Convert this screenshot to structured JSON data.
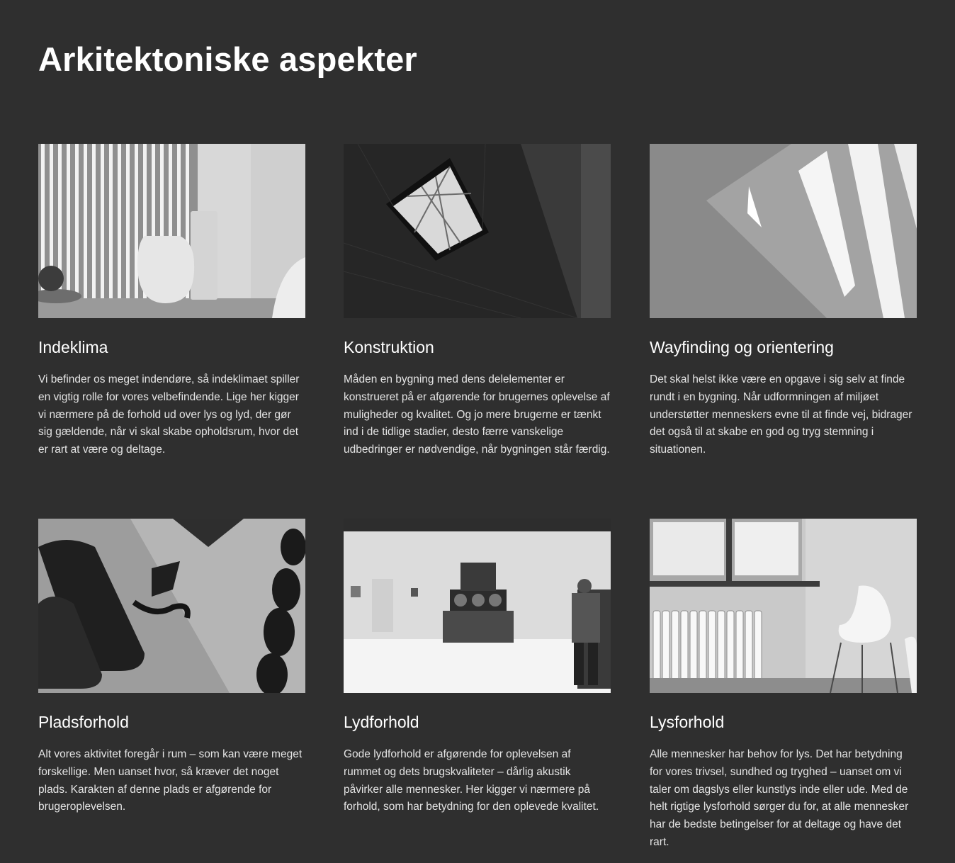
{
  "page": {
    "title": "Arkitektoniske aspekter"
  },
  "cards": [
    {
      "title": "Indeklima",
      "text": "Vi befinder os meget indendøre, så indeklimaet spiller en vigtig rolle for vores velbefindende. Lige her kigger vi nærmere på de forhold ud over lys og lyd, der gør sig gældende, når vi skal skabe opholdsrum, hvor det er rart at være og deltage."
    },
    {
      "title": "Konstruktion",
      "text": "Måden en bygning med dens delelementer er konstrueret på er afgørende for brugernes oplevelse af muligheder og kvalitet. Og jo mere brugerne er tænkt ind i de tidlige stadier, desto færre vanskelige udbedringer er nødvendige, når bygningen står færdig."
    },
    {
      "title": "Wayfinding og orientering",
      "text": "Det skal helst ikke være en opgave i sig selv at finde rundt i en bygning. Når udformningen af miljøet understøtter menneskers evne til at finde vej, bidrager det også til at skabe en god og tryg stemning i situationen."
    },
    {
      "title": "Pladsforhold",
      "text": "Alt vores aktivitet foregår i rum – som kan være meget forskellige. Men uanset hvor, så kræver det noget plads. Karakten af denne plads er afgørende for brugeroplevelsen."
    },
    {
      "title": "Lydforhold",
      "text": "Gode lydforhold er afgørende for oplevelsen af rummet og dets brugskvaliteter – dårlig akustik påvirker alle mennesker. Her kigger vi nærmere på forhold, som har betydning for den oplevede kvalitet."
    },
    {
      "title": "Lysforhold",
      "text": "Alle mennesker har behov for lys. Det har betydning for vores trivsel, sundhed og tryghed – uanset om vi taler om dagslys eller kunstlys inde eller ude. Med de helt rigtige lysforhold sørger du for, at alle mennesker har de bedste betingelser for at deltage og have det rart."
    }
  ],
  "colors": {
    "background": "#2f2f2f",
    "text": "#ffffff",
    "body_text": "#e4e4e4"
  }
}
